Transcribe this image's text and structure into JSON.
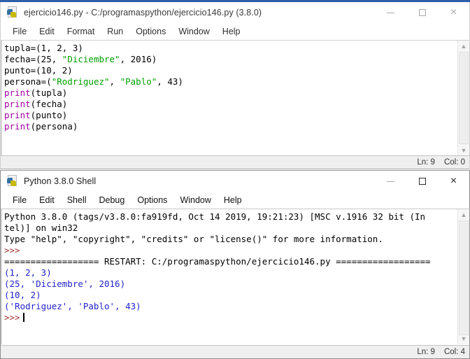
{
  "editor": {
    "title": "ejercicio146.py - C:/programaspython/ejercicio146.py (3.8.0)",
    "icon": "python-file-icon",
    "controls": {
      "minimize": "minimize-icon",
      "maximize": "maximize-icon",
      "close": "×"
    },
    "menus": [
      "File",
      "Edit",
      "Format",
      "Run",
      "Options",
      "Window",
      "Help"
    ],
    "code_lines": [
      [
        {
          "t": "tupla=(1, 2, 3)",
          "c": "plain"
        }
      ],
      [
        {
          "t": "fecha=(25, ",
          "c": "plain"
        },
        {
          "t": "\"Diciembre\"",
          "c": "str"
        },
        {
          "t": ", 2016)",
          "c": "plain"
        }
      ],
      [
        {
          "t": "punto=(10, 2)",
          "c": "plain"
        }
      ],
      [
        {
          "t": "persona=(",
          "c": "plain"
        },
        {
          "t": "\"Rodriguez\"",
          "c": "str"
        },
        {
          "t": ", ",
          "c": "plain"
        },
        {
          "t": "\"Pablo\"",
          "c": "str"
        },
        {
          "t": ", 43)",
          "c": "plain"
        }
      ],
      [
        {
          "t": "print",
          "c": "kw"
        },
        {
          "t": "(tupla)",
          "c": "plain"
        }
      ],
      [
        {
          "t": "print",
          "c": "kw"
        },
        {
          "t": "(fecha)",
          "c": "plain"
        }
      ],
      [
        {
          "t": "print",
          "c": "kw"
        },
        {
          "t": "(punto)",
          "c": "plain"
        }
      ],
      [
        {
          "t": "print",
          "c": "kw"
        },
        {
          "t": "(persona)",
          "c": "plain"
        }
      ]
    ],
    "status": {
      "line": "Ln: 9",
      "col": "Col: 0"
    }
  },
  "shell": {
    "title": "Python 3.8.0 Shell",
    "icon": "python-file-icon",
    "controls": {
      "minimize": "minimize-icon",
      "maximize": "maximize-icon",
      "close": "×"
    },
    "menus": [
      "File",
      "Edit",
      "Shell",
      "Debug",
      "Options",
      "Window",
      "Help"
    ],
    "output_lines": [
      [
        {
          "t": "Python 3.8.0 (tags/v3.8.0:fa919fd, Oct 14 2019, 19:21:23) [MSC v.1916 32 bit (In",
          "c": "plain"
        }
      ],
      [
        {
          "t": "tel)] on win32",
          "c": "plain"
        }
      ],
      [
        {
          "t": "Type \"help\", \"copyright\", \"credits\" or \"license()\" for more information.",
          "c": "plain"
        }
      ],
      [
        {
          "t": ">>>",
          "c": "prompt"
        }
      ],
      [
        {
          "t": "================== RESTART: C:/programaspython/ejercicio146.py ==================",
          "c": "plain"
        }
      ],
      [
        {
          "t": "(1, 2, 3)",
          "c": "out"
        }
      ],
      [
        {
          "t": "(25, 'Diciembre', 2016)",
          "c": "out"
        }
      ],
      [
        {
          "t": "(10, 2)",
          "c": "out"
        }
      ],
      [
        {
          "t": "('Rodriguez', 'Pablo', 43)",
          "c": "out"
        }
      ],
      [
        {
          "t": ">>>",
          "c": "prompt"
        },
        {
          "t": "__CARET__",
          "c": "caret"
        }
      ]
    ],
    "status": {
      "line": "Ln: 9",
      "col": "Col: 4"
    }
  },
  "colors": {
    "string": "#00a000",
    "keyword": "#a000a0",
    "stdout": "#2222cc",
    "prompt": "#a03030",
    "accent": "#2d5fa8"
  }
}
